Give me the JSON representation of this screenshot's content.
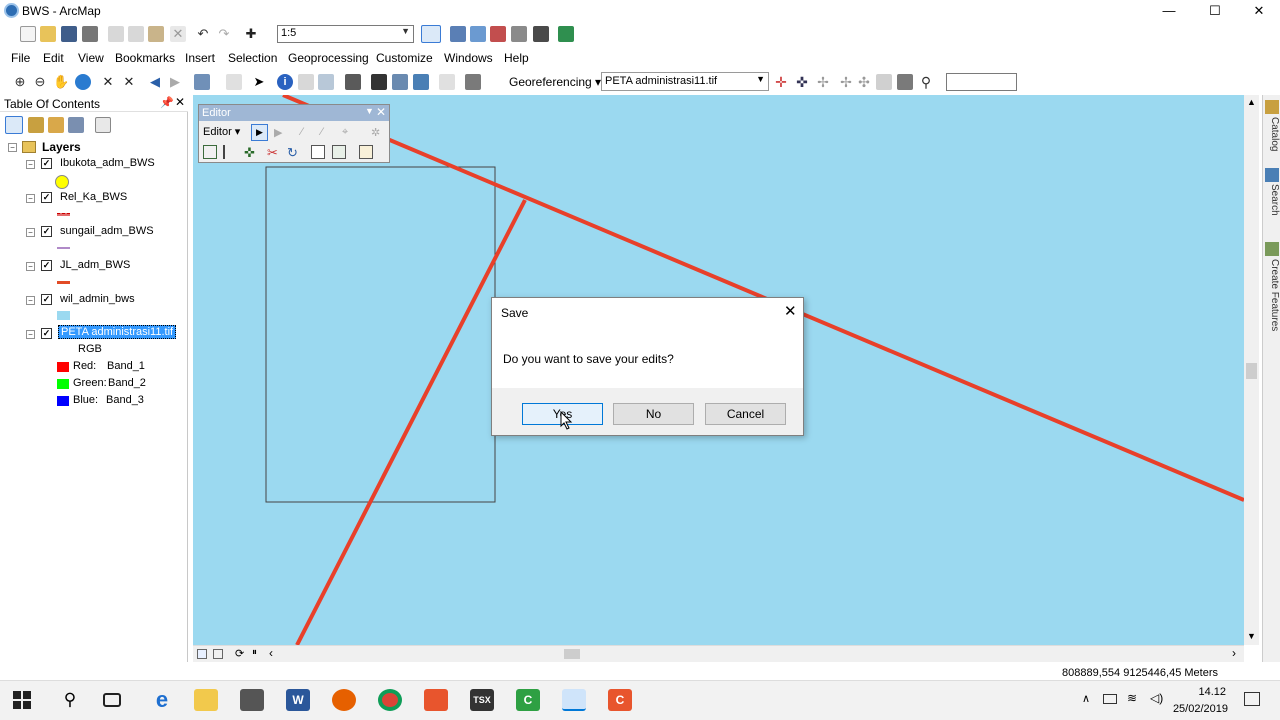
{
  "window": {
    "title": "BWS - ArcMap",
    "minimize": "—",
    "maximize": "☐",
    "close": "✕"
  },
  "standard_toolbar": {
    "scale": "1:5"
  },
  "menu": [
    "File",
    "Edit",
    "View",
    "Bookmarks",
    "Insert",
    "Selection",
    "Geoprocessing",
    "Customize",
    "Windows",
    "Help"
  ],
  "georef_toolbar": {
    "label": "Georeferencing ▾",
    "layer": "PETA administrasi11.tif"
  },
  "toc": {
    "title": "Table Of Contents",
    "root": "Layers",
    "layers": [
      {
        "name": "Ibukota_adm_BWS",
        "checked": true,
        "symbol_color": "#ffff00"
      },
      {
        "name": "Rel_Ka_BWS",
        "checked": true,
        "symbol_color": "#e36c6c"
      },
      {
        "name": "sungail_adm_BWS",
        "checked": true,
        "symbol_color": "#b08ac8"
      },
      {
        "name": "JL_adm_BWS",
        "checked": true,
        "symbol_color": "#e24b26"
      },
      {
        "name": "wil_admin_bws",
        "checked": true,
        "symbol_color": "#9bd9f0"
      },
      {
        "name": "PETA administrasi11.tif",
        "checked": true,
        "selected": true
      }
    ],
    "raster": {
      "mode": "RGB",
      "bands": [
        {
          "label": "Red:",
          "band": "Band_1",
          "color": "#ff0000"
        },
        {
          "label": "Green:",
          "band": "Band_2",
          "color": "#00ff00"
        },
        {
          "label": "Blue:",
          "band": "Band_3",
          "color": "#0000ff"
        }
      ]
    }
  },
  "editor_toolbar": {
    "title": "Editor",
    "menu": "Editor ▾"
  },
  "right_dock": [
    "Catalog",
    "Search",
    "Create Features"
  ],
  "dialog": {
    "title": "Save",
    "message": "Do you want to save your edits?",
    "yes": "Yes",
    "no": "No",
    "cancel": "Cancel"
  },
  "status": {
    "coords": "808889,554  9125446,45 Meters"
  },
  "taskbar": {
    "time": "14.12",
    "date": "25/02/2019"
  },
  "colors": {
    "map_bg": "#9bd9f0",
    "road": "#e8402a",
    "accent": "#0078d7"
  }
}
